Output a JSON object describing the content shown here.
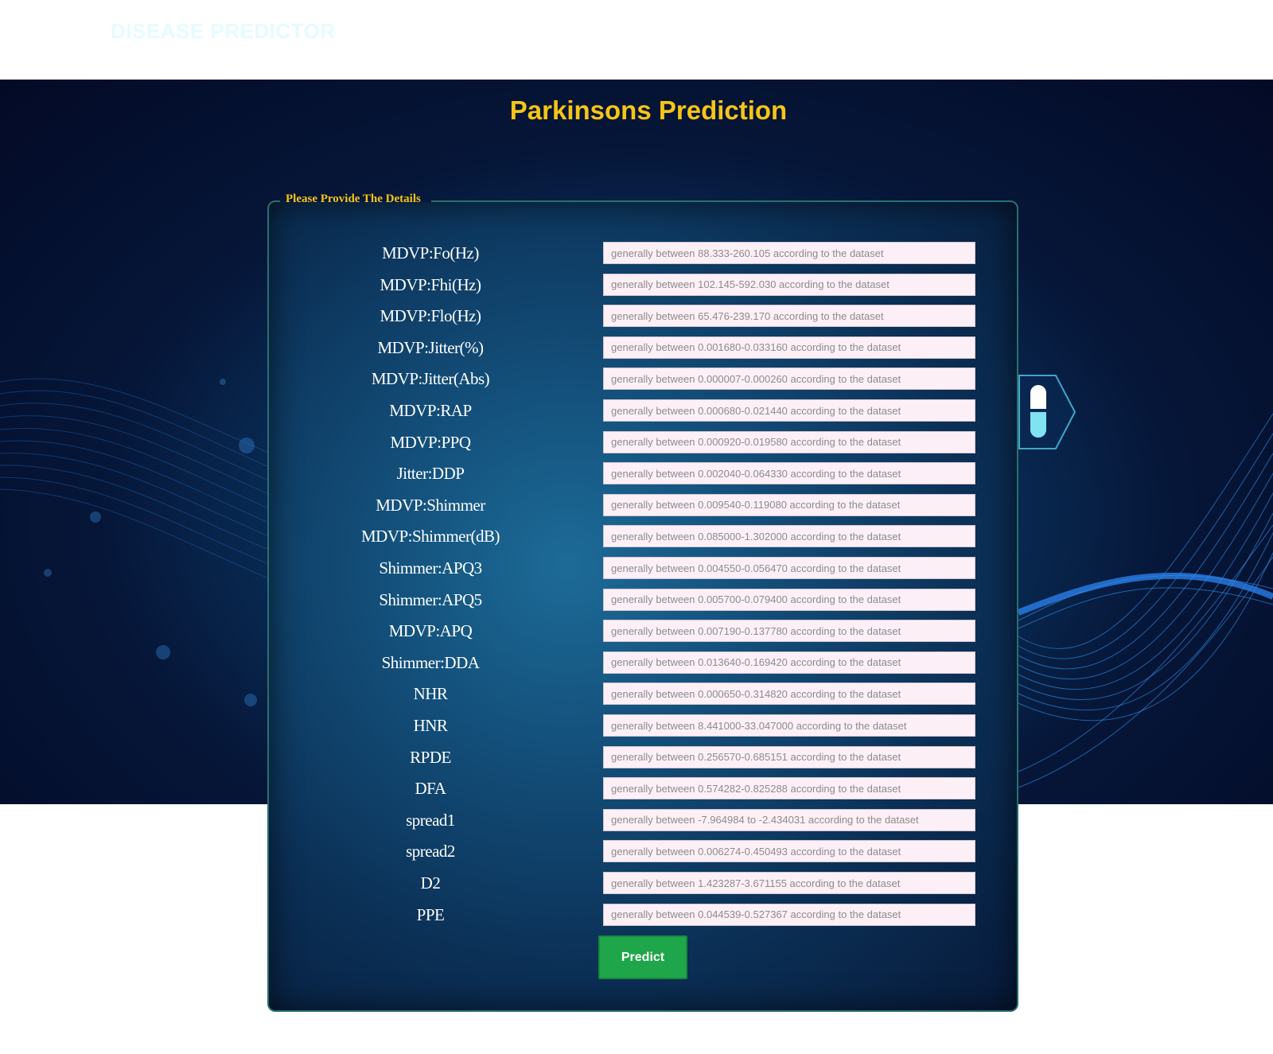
{
  "navbar": {
    "brand": "DISEASE PREDICTOR"
  },
  "page": {
    "title": "Parkinsons Prediction"
  },
  "form": {
    "legend": "Please Provide The Details",
    "fields": [
      {
        "label": "MDVP:Fo(Hz)",
        "placeholder": "generally between 88.333-260.105 according to the dataset"
      },
      {
        "label": "MDVP:Fhi(Hz)",
        "placeholder": "generally between 102.145-592.030 according to the dataset"
      },
      {
        "label": "MDVP:Flo(Hz)",
        "placeholder": "generally between 65.476-239.170 according to the dataset"
      },
      {
        "label": "MDVP:Jitter(%)",
        "placeholder": "generally between 0.001680-0.033160 according to the dataset"
      },
      {
        "label": "MDVP:Jitter(Abs)",
        "placeholder": "generally between 0.000007-0.000260 according to the dataset"
      },
      {
        "label": "MDVP:RAP",
        "placeholder": "generally between 0.000680-0.021440 according to the dataset"
      },
      {
        "label": "MDVP:PPQ",
        "placeholder": "generally between 0.000920-0.019580 according to the dataset"
      },
      {
        "label": "Jitter:DDP",
        "placeholder": "generally between 0.002040-0.064330 according to the dataset"
      },
      {
        "label": "MDVP:Shimmer",
        "placeholder": "generally between 0.009540-0.119080 according to the dataset"
      },
      {
        "label": "MDVP:Shimmer(dB)",
        "placeholder": "generally between 0.085000-1.302000 according to the dataset"
      },
      {
        "label": "Shimmer:APQ3",
        "placeholder": "generally between 0.004550-0.056470 according to the dataset"
      },
      {
        "label": "Shimmer:APQ5",
        "placeholder": "generally between 0.005700-0.079400 according to the dataset"
      },
      {
        "label": "MDVP:APQ",
        "placeholder": "generally between 0.007190-0.137780 according to the dataset"
      },
      {
        "label": "Shimmer:DDA",
        "placeholder": "generally between 0.013640-0.169420 according to the dataset"
      },
      {
        "label": "NHR",
        "placeholder": "generally between 0.000650-0.314820 according to the dataset"
      },
      {
        "label": "HNR",
        "placeholder": "generally between 8.441000-33.047000 according to the dataset"
      },
      {
        "label": "RPDE",
        "placeholder": "generally between 0.256570-0.685151 according to the dataset"
      },
      {
        "label": "DFA",
        "placeholder": "generally between 0.574282-0.825288 according to the dataset"
      },
      {
        "label": "spread1",
        "placeholder": "generally between -7.964984 to -2.434031 according to the dataset"
      },
      {
        "label": "spread2",
        "placeholder": "generally between 0.006274-0.450493 according to the dataset"
      },
      {
        "label": "D2",
        "placeholder": "generally between 1.423287-3.671155 according to the dataset"
      },
      {
        "label": "PPE",
        "placeholder": "generally between 0.044539-0.527367 according to the dataset"
      }
    ],
    "submit_label": "Predict"
  },
  "side_badge": {
    "icon": "capsule-icon"
  },
  "colors": {
    "title": "#f5c518",
    "button": "#1fa64a",
    "input_bg": "#fcf0f6"
  }
}
